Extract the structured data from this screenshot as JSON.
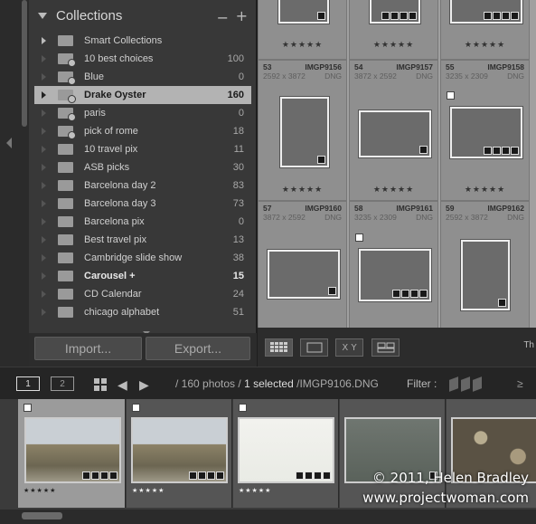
{
  "collections": {
    "title": "Collections",
    "minus_label": "−",
    "plus_label": "+",
    "items": [
      {
        "name": "Smart Collections",
        "count": "",
        "type": "smart"
      },
      {
        "name": "10 best choices",
        "count": "100",
        "type": "gear"
      },
      {
        "name": "Blue",
        "count": "0",
        "type": "gear"
      },
      {
        "name": "Drake Oyster",
        "count": "160",
        "type": "active"
      },
      {
        "name": "paris",
        "count": "0",
        "type": "gear"
      },
      {
        "name": "pick of rome",
        "count": "18",
        "type": "gear"
      },
      {
        "name": "10 travel pix",
        "count": "11",
        "type": "plain"
      },
      {
        "name": "ASB picks",
        "count": "30",
        "type": "plain"
      },
      {
        "name": "Barcelona day 2",
        "count": "83",
        "type": "plain"
      },
      {
        "name": "Barcelona day 3",
        "count": "73",
        "type": "plain"
      },
      {
        "name": "Barcelona pix",
        "count": "0",
        "type": "plain"
      },
      {
        "name": "Best travel pix",
        "count": "13",
        "type": "plain"
      },
      {
        "name": "Cambridge slide show",
        "count": "38",
        "type": "plain"
      },
      {
        "name": "Carousel  +",
        "count": "15",
        "type": "bold"
      },
      {
        "name": "CD Calendar",
        "count": "24",
        "type": "plain"
      },
      {
        "name": "chicago alphabet",
        "count": "51",
        "type": "plain"
      }
    ]
  },
  "buttons": {
    "import": "Import...",
    "export": "Export..."
  },
  "grid": {
    "stars": "★★★★★",
    "cells": [
      {
        "num": "53",
        "name": "IMGP9156",
        "dims": "2592 x 3872",
        "fmt": "DNG"
      },
      {
        "num": "54",
        "name": "IMGP9157",
        "dims": "3872 x 2592",
        "fmt": "DNG"
      },
      {
        "num": "55",
        "name": "IMGP9158",
        "dims": "3235 x 2309",
        "fmt": "DNG"
      },
      {
        "num": "57",
        "name": "IMGP9160",
        "dims": "3872 x 2592",
        "fmt": "DNG"
      },
      {
        "num": "58",
        "name": "IMGP9161",
        "dims": "3235 x 2309",
        "fmt": "DNG"
      },
      {
        "num": "59",
        "name": "IMGP9162",
        "dims": "2592 x 3872",
        "fmt": "DNG"
      }
    ]
  },
  "toolbar": {
    "compare_label": "X Y",
    "thumbnails_label": "Th"
  },
  "filmstrip_bar": {
    "monitor1": "1",
    "monitor2": "2",
    "path_prefix": "/ 160 photos /",
    "path_selected": "1 selected",
    "path_file": "/IMGP9106.DNG",
    "filter_label": "Filter :",
    "ge": "≥"
  },
  "filmstrip": {
    "stars": "★★★★★"
  },
  "watermark": {
    "copyright": "© 2011, Helen Bradley",
    "url": "www.projectwoman.com"
  }
}
